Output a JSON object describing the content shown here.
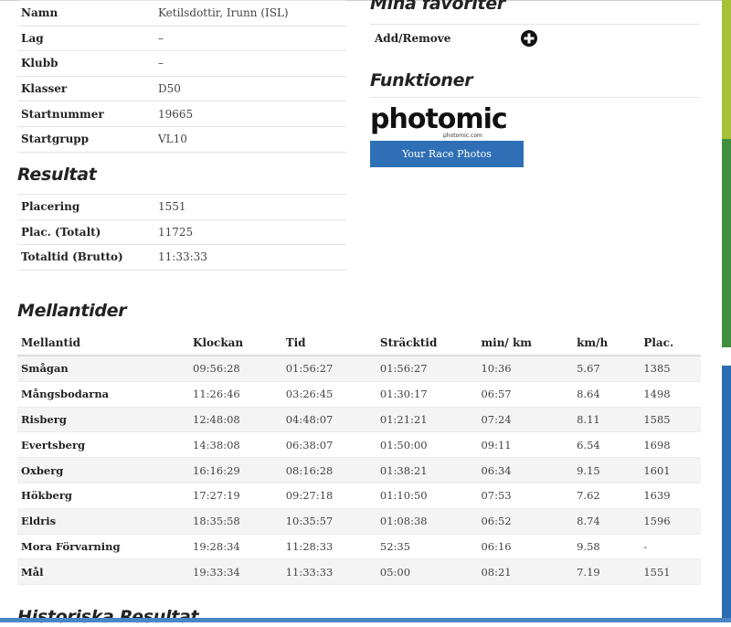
{
  "participant": {
    "rows": [
      {
        "label": "Namn",
        "value": "Ketilsdottir, Irunn (ISL)"
      },
      {
        "label": "Lag",
        "value": "–"
      },
      {
        "label": "Klubb",
        "value": "–"
      },
      {
        "label": "Klasser",
        "value": "D50"
      },
      {
        "label": "Startnummer",
        "value": "19665"
      },
      {
        "label": "Startgrupp",
        "value": "VL10"
      }
    ]
  },
  "result": {
    "title": "Resultat",
    "rows": [
      {
        "label": "Placering",
        "value": "1551"
      },
      {
        "label": "Plac. (Totalt)",
        "value": "11725"
      },
      {
        "label": "Totaltid (Brutto)",
        "value": "11:33:33"
      }
    ]
  },
  "favorites": {
    "title": "Mina favoriter",
    "add_remove": "Add/Remove",
    "icon": "plus-circle-icon"
  },
  "functions": {
    "title": "Funktioner",
    "logo_text": "photomic",
    "logo_sub": "photomic.com",
    "button_label": "Your Race Photos"
  },
  "splits": {
    "title": "Mellantider",
    "columns": [
      "Mellantid",
      "Klockan",
      "Tid",
      "Sträcktid",
      "min/ km",
      "km/h",
      "Plac."
    ],
    "rows": [
      [
        "Smågan",
        "09:56:28",
        "01:56:27",
        "01:56:27",
        "10:36",
        "5.67",
        "1385"
      ],
      [
        "Mångsbodarna",
        "11:26:46",
        "03:26:45",
        "01:30:17",
        "06:57",
        "8.64",
        "1498"
      ],
      [
        "Risberg",
        "12:48:08",
        "04:48:07",
        "01:21:21",
        "07:24",
        "8.11",
        "1585"
      ],
      [
        "Evertsberg",
        "14:38:08",
        "06:38:07",
        "01:50:00",
        "09:11",
        "6.54",
        "1698"
      ],
      [
        "Oxberg",
        "16:16:29",
        "08:16:28",
        "01:38:21",
        "06:34",
        "9.15",
        "1601"
      ],
      [
        "Hökberg",
        "17:27:19",
        "09:27:18",
        "01:10:50",
        "07:53",
        "7.62",
        "1639"
      ],
      [
        "Eldris",
        "18:35:58",
        "10:35:57",
        "01:08:38",
        "06:52",
        "8.74",
        "1596"
      ],
      [
        "Mora Förvarning",
        "19:28:34",
        "11:28:33",
        "52:35",
        "06:16",
        "9.58",
        "-"
      ],
      [
        "Mål",
        "19:33:34",
        "11:33:33",
        "05:00",
        "08:21",
        "7.19",
        "1551"
      ]
    ]
  },
  "history": {
    "title": "Historiska Resultat"
  },
  "colors": {
    "strip_top": "#a6c238",
    "strip_middle": "#3f8f3c",
    "strip_bottom": "#2b6cb0",
    "button": "#2f6fb5"
  }
}
